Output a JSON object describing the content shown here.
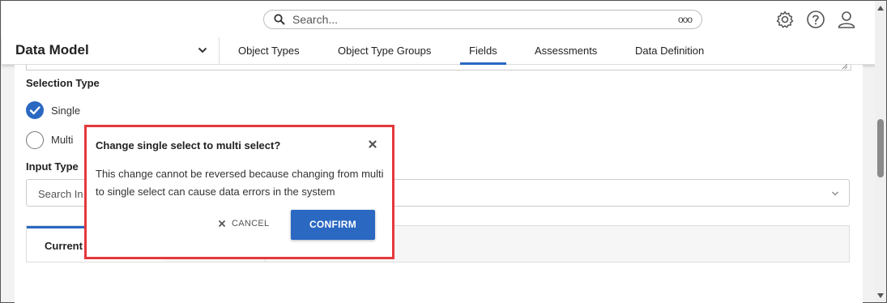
{
  "search": {
    "placeholder": "Search...",
    "more_icon": "ooo"
  },
  "header_icons": [
    "gear-icon",
    "help-icon",
    "user-icon"
  ],
  "nav": {
    "model": "Data Model",
    "tabs": [
      {
        "label": "Object Types",
        "active": false
      },
      {
        "label": "Object Type Groups",
        "active": false
      },
      {
        "label": "Fields",
        "active": true
      },
      {
        "label": "Assessments",
        "active": false
      },
      {
        "label": "Data Definition",
        "active": false
      }
    ]
  },
  "form": {
    "selection_type_label": "Selection Type",
    "options": [
      {
        "label": "Single",
        "checked": true
      },
      {
        "label": "Multi",
        "checked": false
      }
    ],
    "input_type_label": "Input Type",
    "input_type_placeholder": "Search In",
    "tab_current": "Current"
  },
  "modal": {
    "title": "Change single select to multi select?",
    "body": "This change cannot be reversed because changing from multi to single select can cause data errors in the system",
    "cancel_label": "CANCEL",
    "confirm_label": "CONFIRM"
  },
  "colors": {
    "accent": "#2a68c2",
    "highlight": "#e5383b"
  }
}
